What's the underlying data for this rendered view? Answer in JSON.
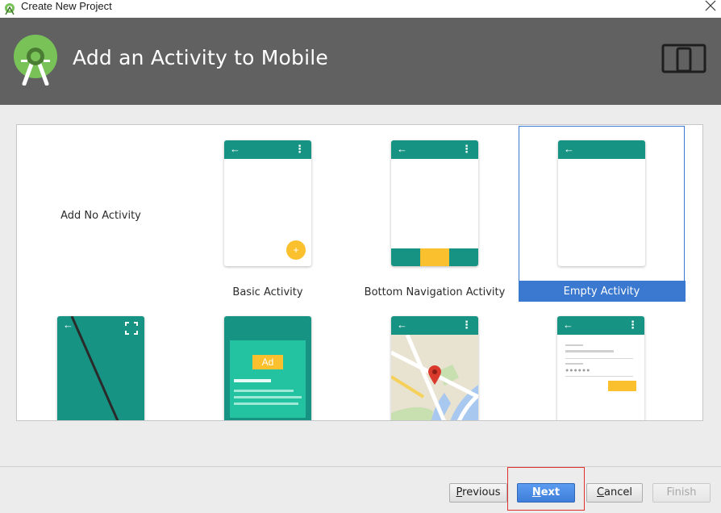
{
  "window": {
    "title": "Create New Project"
  },
  "header": {
    "title": "Add an Activity to Mobile"
  },
  "gallery": {
    "items": [
      {
        "label": "Add No Activity"
      },
      {
        "label": "Basic Activity",
        "fab_glyph": "+"
      },
      {
        "label": "Bottom Navigation Activity"
      },
      {
        "label": "Empty Activity",
        "selected": true
      },
      {
        "label": ""
      },
      {
        "label": "",
        "ad_text": "Ad"
      },
      {
        "label": ""
      },
      {
        "label": ""
      }
    ]
  },
  "icons": {
    "back": "←",
    "menu": "⋮",
    "close": "close-icon",
    "logo": "android-studio-logo",
    "device": "tablet-phone-icon",
    "fullscreen": "fullscreen-icon",
    "map_pin": "map-pin-icon"
  },
  "colors": {
    "header_bg": "#616161",
    "teal": "#169383",
    "amber": "#fbc02d",
    "selection": "#3a79cf",
    "highlight_box": "#e0302b"
  },
  "buttons": {
    "previous": {
      "prefix": "",
      "mnemonic": "P",
      "rest": "revious"
    },
    "next": {
      "prefix": "",
      "mnemonic": "N",
      "rest": "ext"
    },
    "cancel": {
      "prefix": "",
      "mnemonic": "C",
      "rest": "ancel"
    },
    "finish": {
      "label": "Finish",
      "enabled": false
    }
  }
}
